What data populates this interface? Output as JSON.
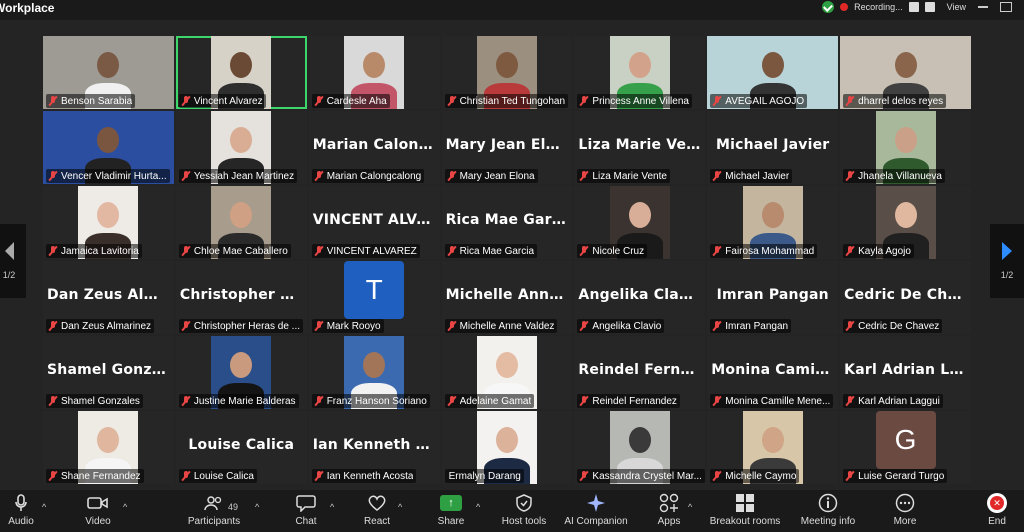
{
  "app": {
    "title": "Workplace",
    "recording_label": "Recording...",
    "view_label": "View"
  },
  "nav": {
    "left_page": "1/2",
    "right_page": "1/2"
  },
  "participants": [
    {
      "name": "Benson Sarabia",
      "kind": "video",
      "bg": "#9e9a94",
      "skin": "#7a5a45",
      "shirt": "#f0f0f0"
    },
    {
      "name": "Vincent Alvarez",
      "kind": "video",
      "bg": "#d6d2c8",
      "skin": "#6b4a35",
      "shirt": "#2e2e2e",
      "active": true
    },
    {
      "name": "Cardesle Aha",
      "kind": "video",
      "bg": "#d9d9d9",
      "skin": "#b98a6a",
      "shirt": "#c25568"
    },
    {
      "name": "Christian Ted Tungohan",
      "kind": "video",
      "bg": "#9b8f80",
      "skin": "#7e5a40",
      "shirt": "#b83a3a"
    },
    {
      "name": "Princess Anne Villena",
      "kind": "video",
      "bg": "#c9d0c4",
      "skin": "#d2a38a",
      "shirt": "#37a04a"
    },
    {
      "name": "AVEGAIL AGOJO",
      "kind": "video",
      "bg": "#b8d4d8",
      "skin": "#7b5740",
      "shirt": "#333333"
    },
    {
      "name": "dharrel delos reyes",
      "kind": "video",
      "bg": "#c8c0b4",
      "skin": "#8a654c",
      "shirt": "#404040"
    },
    {
      "name": "Vencer Vladimir Hurta...",
      "kind": "video",
      "bg": "#2c4ea0",
      "skin": "#7a5540",
      "shirt": "#222222"
    },
    {
      "name": "Yessiah Jean Martinez",
      "kind": "video",
      "bg": "#e5e2de",
      "skin": "#d9ad93",
      "shirt": "#262626"
    },
    {
      "name": "Marian Calongcalong",
      "kind": "text",
      "big": "Marian  Calongc..."
    },
    {
      "name": "Mary Jean Elona",
      "kind": "text",
      "big": "Mary Jean Elona"
    },
    {
      "name": "Liza Marie Vente",
      "kind": "text",
      "big": "Liza Marie Vente"
    },
    {
      "name": "Michael Javier",
      "kind": "text",
      "big": "Michael Javier"
    },
    {
      "name": "Jhanela Villanueva",
      "kind": "video",
      "bg": "#a8b89a",
      "skin": "#caa088",
      "shirt": "#2e5a2e"
    },
    {
      "name": "Jamaica Lavitoria",
      "kind": "video",
      "bg": "#eeeae6",
      "skin": "#e2b8a2",
      "shirt": "#3a2e2a"
    },
    {
      "name": "Chloe Mae Caballero",
      "kind": "video",
      "bg": "#a89c8c",
      "skin": "#d0a084",
      "shirt": "#2a2a2a"
    },
    {
      "name": "VINCENT ALVAREZ",
      "kind": "text",
      "big": "VINCENT  ALVA..."
    },
    {
      "name": "Rica Mae Garcia",
      "kind": "text",
      "big": "Rica Mae Garcia"
    },
    {
      "name": "Nicole Cruz",
      "kind": "video",
      "bg": "#3a3330",
      "skin": "#d8ae98",
      "shirt": "#1a1a1a"
    },
    {
      "name": "Fairosa Mohammad",
      "kind": "video",
      "bg": "#c4b69e",
      "skin": "#b88a6e",
      "shirt": "#3b5a8a"
    },
    {
      "name": "Kayla Agojo",
      "kind": "video",
      "bg": "#5a4e48",
      "skin": "#e0b8a0",
      "shirt": "#202020"
    },
    {
      "name": "Dan Zeus Almarinez",
      "kind": "text",
      "big": "Dan Zeus  Almar..."
    },
    {
      "name": "Christopher Heras de ...",
      "kind": "text",
      "big": "Christopher  Her..."
    },
    {
      "name": "Mark Rooyo",
      "kind": "avatar",
      "letter": "T",
      "color": "#1f5fbf"
    },
    {
      "name": "Michelle Anne Valdez",
      "kind": "text",
      "big": "Michelle  Anne..."
    },
    {
      "name": "Angelika Clavio",
      "kind": "text",
      "big": "Angelika Clavio"
    },
    {
      "name": "Imran Pangan",
      "kind": "text",
      "big": "Imran Pangan"
    },
    {
      "name": "Cedric De Chavez",
      "kind": "text",
      "big": "Cedric De Chavez"
    },
    {
      "name": "Shamel Gonzales",
      "kind": "text",
      "big": "Shamel Gonzales"
    },
    {
      "name": "Justine Marie Balderas",
      "kind": "video",
      "bg": "#2a4e8a",
      "skin": "#c99a7e",
      "shirt": "#141414"
    },
    {
      "name": "Franz Hanson Soriano",
      "kind": "video",
      "bg": "#3c6ab0",
      "skin": "#a27458",
      "shirt": "#f2f2f2"
    },
    {
      "name": "Adelaine Gamat",
      "kind": "video",
      "bg": "#f3f1ee",
      "skin": "#e4bca4",
      "shirt": "#f7f7f7"
    },
    {
      "name": "Reindel Fernandez",
      "kind": "text",
      "big": "Reindel  Fernan..."
    },
    {
      "name": "Monina Camille Mene...",
      "kind": "text",
      "big": "Monina  Camille..."
    },
    {
      "name": "Karl Adrian Laggui",
      "kind": "text",
      "big": "Karl Adrian  Lag..."
    },
    {
      "name": "Shane Fernandez",
      "kind": "video",
      "bg": "#eeeae4",
      "skin": "#e0b69e",
      "shirt": "#f5f5f5"
    },
    {
      "name": "Louise Calica",
      "kind": "text",
      "big": "Louise Calica"
    },
    {
      "name": "Ian Kenneth Acosta",
      "kind": "text",
      "big": "Ian  Kenneth  Ac..."
    },
    {
      "name": "Ermalyn Darang",
      "kind": "video",
      "bg": "#f4f2f0",
      "skin": "#dcb29a",
      "shirt": "#1d2a44",
      "nomute": true
    },
    {
      "name": "Kassandra Crystel Mar...",
      "kind": "video",
      "bg": "#b6b8b4",
      "skin": "#3a3a3a",
      "shirt": "#d8d8d8"
    },
    {
      "name": "Michelle Caymo",
      "kind": "video",
      "bg": "#d8c6a8",
      "skin": "#d0a486",
      "shirt": "#3a3a3a"
    },
    {
      "name": "Luise Gerard Turgo",
      "kind": "avatar",
      "letter": "G",
      "color": "#6b4a42"
    }
  ],
  "toolbar": {
    "audio": "Audio",
    "video": "Video",
    "participants": "Participants",
    "participants_count": "49",
    "chat": "Chat",
    "react": "React",
    "share": "Share",
    "host_tools": "Host tools",
    "ai_companion": "AI Companion",
    "apps": "Apps",
    "breakout_rooms": "Breakout rooms",
    "meeting_info": "Meeting info",
    "more": "More",
    "end": "End"
  },
  "colors": {
    "background": "#242424",
    "active_speaker": "#3dd66a",
    "mute_red": "#e84545",
    "share_green": "#2ea043"
  }
}
